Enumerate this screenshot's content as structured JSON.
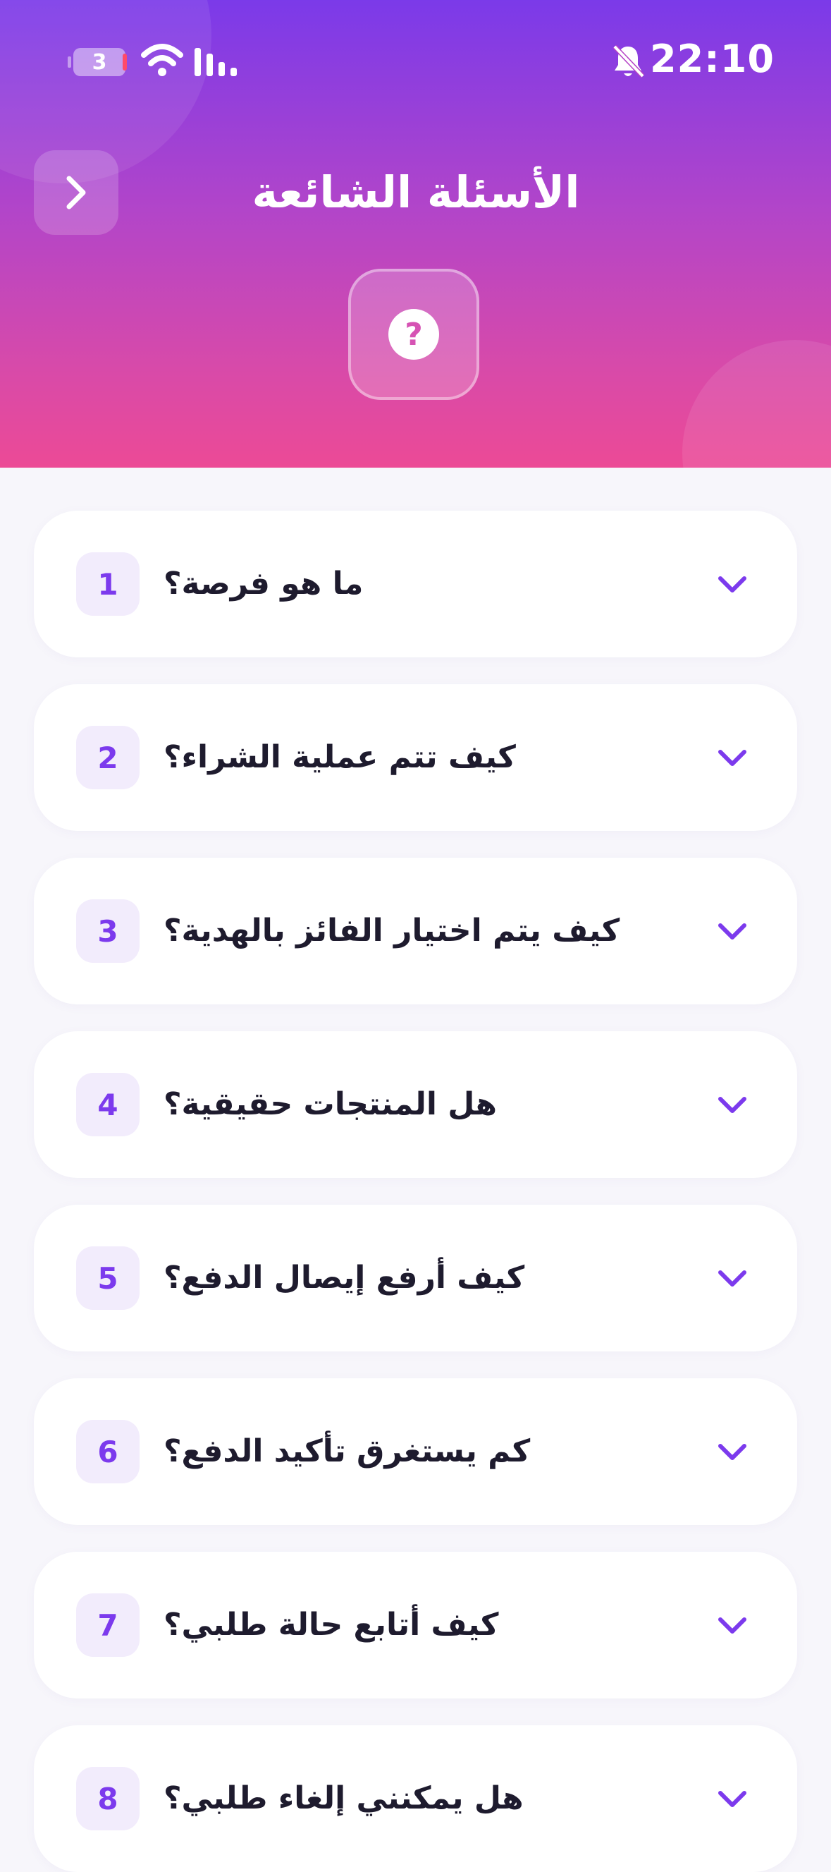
{
  "status_bar": {
    "battery_level": "3",
    "time": "22:10"
  },
  "header": {
    "title": "الأسئلة الشائعة"
  },
  "faq": {
    "items": [
      {
        "number": "1",
        "question": "ما هو فرصة؟"
      },
      {
        "number": "2",
        "question": "كيف تتم عملية الشراء؟"
      },
      {
        "number": "3",
        "question": "كيف يتم اختيار الفائز بالهدية؟"
      },
      {
        "number": "4",
        "question": "هل المنتجات حقيقية؟"
      },
      {
        "number": "5",
        "question": "كيف أرفع إيصال الدفع؟"
      },
      {
        "number": "6",
        "question": "كم يستغرق تأكيد الدفع؟"
      },
      {
        "number": "7",
        "question": "كيف أتابع حالة طلبي؟"
      },
      {
        "number": "8",
        "question": "هل يمكنني إلغاء طلبي؟"
      }
    ]
  },
  "colors": {
    "accent": "#7c3aed",
    "gradient_top": "#7b3ae9",
    "gradient_bottom": "#ec4a96",
    "background": "#f7f6fb",
    "text": "#1e1b2e"
  },
  "icons": {
    "back": "chevron-right-icon",
    "hero": "question-circle-icon",
    "expand": "chevron-down-icon"
  }
}
